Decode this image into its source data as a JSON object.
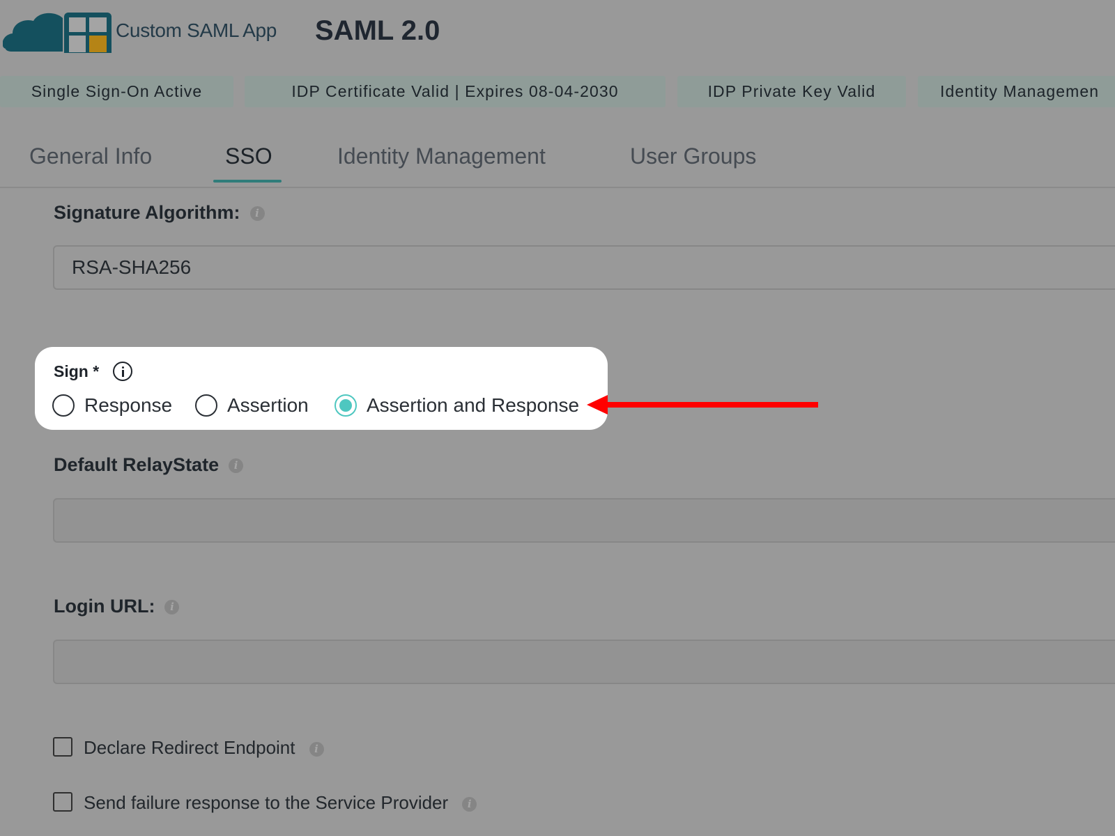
{
  "header": {
    "app_name": "Custom SAML App",
    "protocol": "SAML 2.0",
    "logo_colors": {
      "cloud": "#14505e",
      "grid": "#14505e",
      "accent": "#b58416"
    }
  },
  "status_badges": [
    {
      "label": "Single Sign-On Active"
    },
    {
      "label": "IDP Certificate Valid | Expires 08-04-2030"
    },
    {
      "label": "IDP Private Key Valid"
    },
    {
      "label": "Identity Managemen"
    }
  ],
  "tabs": [
    {
      "label": "General Info",
      "active": false
    },
    {
      "label": "SSO",
      "active": true
    },
    {
      "label": "Identity Management",
      "active": false
    },
    {
      "label": "User Groups",
      "active": false
    }
  ],
  "signature_algorithm": {
    "label": "Signature Algorithm:",
    "value": "RSA-SHA256"
  },
  "sign": {
    "label": "Sign *",
    "options": [
      {
        "label": "Response",
        "checked": false
      },
      {
        "label": "Assertion",
        "checked": false
      },
      {
        "label": "Assertion and Response",
        "checked": true
      }
    ]
  },
  "default_relay_state": {
    "label": "Default RelayState",
    "value": ""
  },
  "login_url": {
    "label": "Login URL:",
    "value": ""
  },
  "checkboxes": [
    {
      "label": "Declare Redirect Endpoint",
      "checked": false
    },
    {
      "label": "Send failure response to the Service Provider",
      "checked": false
    }
  ],
  "colors": {
    "accent": "#4ec7c0",
    "annotation_arrow": "#ff0000",
    "tab_underline": "#2f7c7a"
  }
}
